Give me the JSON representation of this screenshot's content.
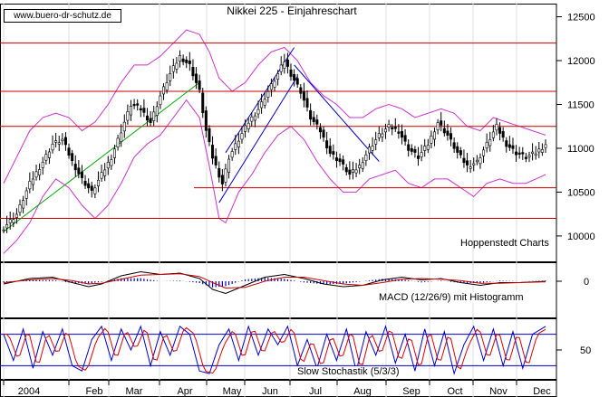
{
  "chart_data": {
    "type": "candlestick",
    "title": "Nikkei 225 - Einjahreschart",
    "watermark": "www.buero-dr-schutz.de",
    "source": "Hoppenstedt Charts",
    "x_tick_labels": [
      "2004",
      "Feb",
      "Mar",
      "Apr",
      "May",
      "Jun",
      "Jul",
      "Aug",
      "Sep",
      "Oct",
      "Nov",
      "Dec"
    ],
    "y_ticks": [
      10000,
      10500,
      11000,
      11500,
      12000,
      12500
    ],
    "ylim": [
      9700,
      12650
    ],
    "horizontal_levels": [
      12200,
      11650,
      11250,
      10550,
      10200
    ],
    "colors": {
      "price": "#000000",
      "bollinger": "#cc33cc",
      "levels": "#cc0000",
      "uptrend": "#00aa00",
      "channel": "#0000cc",
      "macd": "#000000",
      "macd_signal": "#cc0000",
      "histogram": "#0000cc",
      "stoch_k": "#0000cc",
      "stoch_d": "#dd0000"
    },
    "price_keypoints": [
      [
        0,
        10100
      ],
      [
        4,
        10250
      ],
      [
        8,
        10600
      ],
      [
        12,
        10850
      ],
      [
        15,
        11050
      ],
      [
        18,
        11100
      ],
      [
        21,
        10850
      ],
      [
        24,
        10650
      ],
      [
        27,
        10500
      ],
      [
        30,
        10700
      ],
      [
        33,
        10900
      ],
      [
        36,
        11200
      ],
      [
        39,
        11500
      ],
      [
        42,
        11450
      ],
      [
        45,
        11300
      ],
      [
        48,
        11600
      ],
      [
        51,
        11850
      ],
      [
        54,
        12050
      ],
      [
        57,
        11950
      ],
      [
        60,
        11650
      ],
      [
        62,
        11200
      ],
      [
        64,
        10900
      ],
      [
        66,
        10700
      ],
      [
        67,
        10600
      ],
      [
        69,
        10900
      ],
      [
        72,
        11100
      ],
      [
        75,
        11300
      ],
      [
        78,
        11450
      ],
      [
        81,
        11650
      ],
      [
        84,
        11850
      ],
      [
        86,
        12000
      ],
      [
        88,
        11850
      ],
      [
        91,
        11650
      ],
      [
        94,
        11350
      ],
      [
        97,
        11200
      ],
      [
        100,
        10950
      ],
      [
        103,
        10850
      ],
      [
        106,
        10700
      ],
      [
        109,
        10800
      ],
      [
        112,
        11000
      ],
      [
        115,
        11150
      ],
      [
        118,
        11250
      ],
      [
        121,
        11200
      ],
      [
        124,
        11000
      ],
      [
        127,
        10900
      ],
      [
        130,
        11050
      ],
      [
        133,
        11300
      ],
      [
        136,
        11150
      ],
      [
        139,
        10950
      ],
      [
        142,
        10800
      ],
      [
        145,
        10850
      ],
      [
        148,
        11050
      ],
      [
        151,
        11250
      ],
      [
        154,
        11050
      ],
      [
        157,
        10950
      ],
      [
        160,
        10900
      ],
      [
        163,
        10950
      ],
      [
        166,
        11050
      ]
    ],
    "bands": {
      "upper_keypoints": [
        [
          0,
          10600
        ],
        [
          4,
          10900
        ],
        [
          8,
          11200
        ],
        [
          12,
          11350
        ],
        [
          16,
          11400
        ],
        [
          20,
          11350
        ],
        [
          24,
          11200
        ],
        [
          28,
          11300
        ],
        [
          32,
          11500
        ],
        [
          36,
          11750
        ],
        [
          40,
          11950
        ],
        [
          44,
          11950
        ],
        [
          48,
          12050
        ],
        [
          52,
          12200
        ],
        [
          56,
          12350
        ],
        [
          60,
          12300
        ],
        [
          63,
          12100
        ],
        [
          66,
          11800
        ],
        [
          70,
          11650
        ],
        [
          74,
          11750
        ],
        [
          78,
          11950
        ],
        [
          82,
          12100
        ],
        [
          86,
          12150
        ],
        [
          90,
          12000
        ],
        [
          94,
          11750
        ],
        [
          98,
          11600
        ],
        [
          102,
          11500
        ],
        [
          106,
          11350
        ],
        [
          110,
          11350
        ],
        [
          114,
          11450
        ],
        [
          118,
          11500
        ],
        [
          122,
          11450
        ],
        [
          126,
          11350
        ],
        [
          130,
          11400
        ],
        [
          134,
          11450
        ],
        [
          138,
          11400
        ],
        [
          142,
          11250
        ],
        [
          146,
          11200
        ],
        [
          150,
          11350
        ],
        [
          154,
          11300
        ],
        [
          158,
          11250
        ],
        [
          162,
          11200
        ],
        [
          166,
          11150
        ]
      ],
      "lower_keypoints": [
        [
          0,
          9800
        ],
        [
          4,
          9950
        ],
        [
          8,
          10150
        ],
        [
          12,
          10450
        ],
        [
          16,
          10650
        ],
        [
          20,
          10550
        ],
        [
          24,
          10350
        ],
        [
          28,
          10200
        ],
        [
          32,
          10350
        ],
        [
          36,
          10600
        ],
        [
          40,
          10900
        ],
        [
          44,
          11050
        ],
        [
          48,
          11150
        ],
        [
          52,
          11350
        ],
        [
          56,
          11550
        ],
        [
          60,
          11350
        ],
        [
          63,
          10800
        ],
        [
          66,
          10200
        ],
        [
          68,
          10150
        ],
        [
          72,
          10500
        ],
        [
          76,
          10700
        ],
        [
          80,
          10950
        ],
        [
          84,
          11150
        ],
        [
          88,
          11250
        ],
        [
          92,
          11100
        ],
        [
          96,
          10850
        ],
        [
          100,
          10650
        ],
        [
          104,
          10500
        ],
        [
          108,
          10500
        ],
        [
          112,
          10650
        ],
        [
          116,
          10700
        ],
        [
          120,
          10750
        ],
        [
          124,
          10600
        ],
        [
          128,
          10550
        ],
        [
          132,
          10650
        ],
        [
          136,
          10650
        ],
        [
          140,
          10550
        ],
        [
          144,
          10450
        ],
        [
          148,
          10600
        ],
        [
          152,
          10650
        ],
        [
          156,
          10600
        ],
        [
          160,
          10600
        ],
        [
          166,
          10700
        ]
      ]
    },
    "uptrend_line": [
      [
        0,
        10050
      ],
      [
        60,
        11750
      ]
    ],
    "channel": {
      "lower": [
        [
          66,
          10380
        ],
        [
          90,
          11820
        ]
      ],
      "upper": [
        [
          68,
          10950
        ],
        [
          89,
          12150
        ]
      ],
      "down": [
        [
          89,
          11950
        ],
        [
          115,
          10850
        ]
      ]
    },
    "macd": {
      "label": "MACD (12/26/9) mit Histogramm",
      "zero_label": "0",
      "ylim": [
        -120,
        120
      ],
      "macd_keypoints": [
        [
          0,
          -20
        ],
        [
          8,
          20
        ],
        [
          15,
          30
        ],
        [
          21,
          -10
        ],
        [
          26,
          -40
        ],
        [
          30,
          -20
        ],
        [
          36,
          40
        ],
        [
          42,
          70
        ],
        [
          48,
          50
        ],
        [
          54,
          60
        ],
        [
          60,
          20
        ],
        [
          64,
          -60
        ],
        [
          68,
          -90
        ],
        [
          74,
          -30
        ],
        [
          80,
          30
        ],
        [
          86,
          50
        ],
        [
          92,
          20
        ],
        [
          98,
          -20
        ],
        [
          104,
          -40
        ],
        [
          110,
          -30
        ],
        [
          116,
          10
        ],
        [
          122,
          30
        ],
        [
          128,
          10
        ],
        [
          134,
          20
        ],
        [
          140,
          -10
        ],
        [
          146,
          -30
        ],
        [
          152,
          -10
        ],
        [
          158,
          -10
        ],
        [
          166,
          0
        ]
      ],
      "signal_keypoints": [
        [
          0,
          -10
        ],
        [
          8,
          10
        ],
        [
          15,
          20
        ],
        [
          21,
          5
        ],
        [
          26,
          -20
        ],
        [
          30,
          -15
        ],
        [
          36,
          15
        ],
        [
          42,
          45
        ],
        [
          48,
          50
        ],
        [
          54,
          55
        ],
        [
          60,
          35
        ],
        [
          64,
          -10
        ],
        [
          68,
          -50
        ],
        [
          74,
          -45
        ],
        [
          80,
          0
        ],
        [
          86,
          30
        ],
        [
          92,
          30
        ],
        [
          98,
          5
        ],
        [
          104,
          -20
        ],
        [
          110,
          -30
        ],
        [
          116,
          -10
        ],
        [
          122,
          15
        ],
        [
          128,
          20
        ],
        [
          134,
          15
        ],
        [
          140,
          5
        ],
        [
          146,
          -15
        ],
        [
          152,
          -15
        ],
        [
          158,
          -10
        ],
        [
          166,
          -5
        ]
      ]
    },
    "stochastic": {
      "label": "Slow Stochastik (5/3/3)",
      "tick_label": "50",
      "ylim": [
        0,
        100
      ],
      "levels": [
        80,
        20
      ],
      "k_keypoints": [
        [
          0,
          80
        ],
        [
          3,
          30
        ],
        [
          6,
          90
        ],
        [
          9,
          15
        ],
        [
          12,
          85
        ],
        [
          15,
          40
        ],
        [
          18,
          90
        ],
        [
          21,
          20
        ],
        [
          24,
          10
        ],
        [
          27,
          70
        ],
        [
          30,
          95
        ],
        [
          33,
          30
        ],
        [
          36,
          90
        ],
        [
          39,
          50
        ],
        [
          42,
          95
        ],
        [
          45,
          20
        ],
        [
          48,
          85
        ],
        [
          51,
          40
        ],
        [
          54,
          95
        ],
        [
          57,
          80
        ],
        [
          60,
          10
        ],
        [
          63,
          5
        ],
        [
          66,
          60
        ],
        [
          69,
          90
        ],
        [
          72,
          30
        ],
        [
          75,
          95
        ],
        [
          78,
          40
        ],
        [
          81,
          90
        ],
        [
          84,
          60
        ],
        [
          87,
          95
        ],
        [
          90,
          20
        ],
        [
          93,
          70
        ],
        [
          96,
          15
        ],
        [
          99,
          80
        ],
        [
          102,
          30
        ],
        [
          105,
          90
        ],
        [
          108,
          10
        ],
        [
          111,
          85
        ],
        [
          114,
          40
        ],
        [
          117,
          95
        ],
        [
          120,
          25
        ],
        [
          123,
          80
        ],
        [
          126,
          10
        ],
        [
          129,
          90
        ],
        [
          132,
          20
        ],
        [
          135,
          85
        ],
        [
          138,
          5
        ],
        [
          141,
          60
        ],
        [
          144,
          95
        ],
        [
          147,
          30
        ],
        [
          150,
          90
        ],
        [
          153,
          20
        ],
        [
          156,
          85
        ],
        [
          159,
          15
        ],
        [
          162,
          80
        ],
        [
          166,
          95
        ]
      ]
    }
  }
}
